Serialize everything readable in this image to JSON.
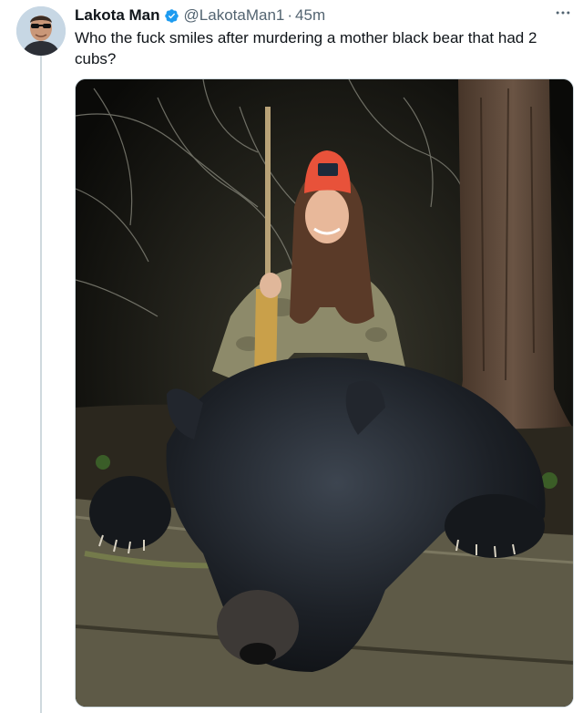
{
  "tweet": {
    "author": {
      "display_name": "Lakota Man",
      "handle": "@LakotaMan1",
      "verified_icon": "verified-badge-icon",
      "avatar_icon": "avatar-photo"
    },
    "separator": "·",
    "timestamp": "45m",
    "text": "Who the fuck smiles after murdering a mother black bear that had 2 cubs?",
    "more_icon": "more-horizontal-icon",
    "media": {
      "type": "photo",
      "alt": "",
      "watermark_text": "",
      "hat_patch_icon": "logo-patch"
    }
  },
  "colors": {
    "text_primary": "#0f1419",
    "text_secondary": "#536471",
    "verified": "#1d9bf0",
    "thread_line": "#cfd9de",
    "hat": "#e8523a"
  }
}
